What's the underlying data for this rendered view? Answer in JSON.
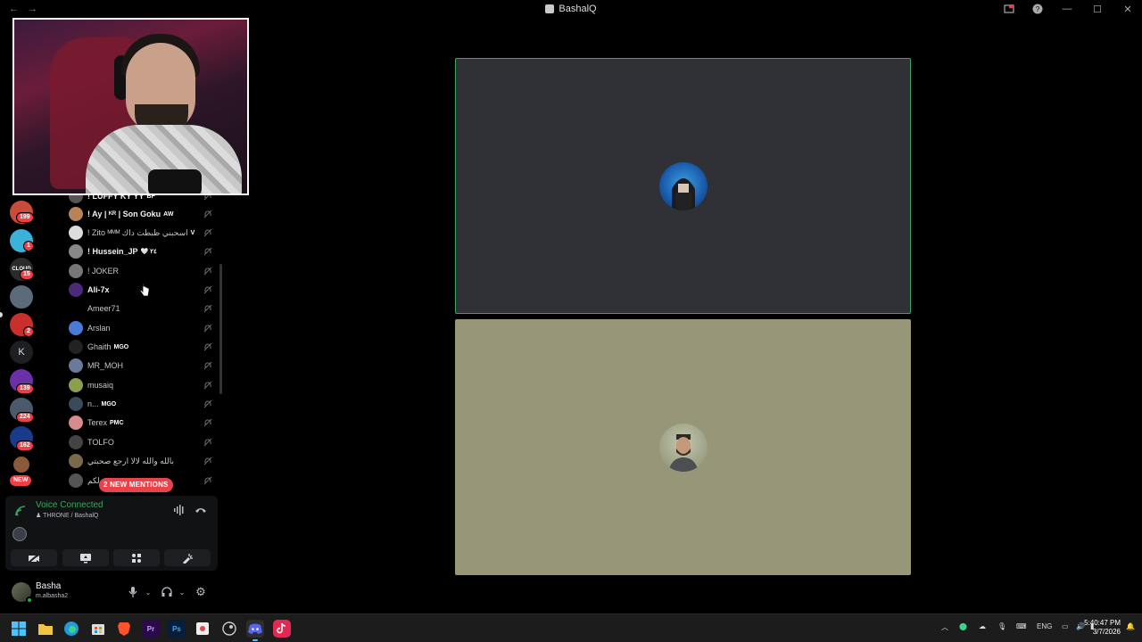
{
  "window": {
    "title": "BashalQ",
    "back": "←",
    "forward": "→",
    "minimize": "—",
    "maximize": "☐",
    "close": "✕"
  },
  "rail": {
    "servers": [
      {
        "name": "server-1",
        "badge": "199",
        "color": "#c94b3a"
      },
      {
        "name": "server-2",
        "badge": "1",
        "color": "#3ab2d9"
      },
      {
        "name": "server-3",
        "badge": "15",
        "label": "CLOUD",
        "color": "#3b3b3b"
      },
      {
        "name": "server-4",
        "badge": "",
        "color": "#5b6b7a"
      },
      {
        "name": "server-5",
        "badge": "2",
        "color": "#c9302c"
      },
      {
        "name": "server-6",
        "badge": "",
        "label": "K",
        "color": "#1e1f22"
      },
      {
        "name": "server-7",
        "badge": "139",
        "color": "#6b2fa8"
      },
      {
        "name": "server-8",
        "badge": "224",
        "color": "#4a5a6a"
      },
      {
        "name": "server-9",
        "badge": "162",
        "color": "#1a3a8a"
      },
      {
        "name": "server-10",
        "badge": "",
        "color": "#8a5a3a"
      }
    ],
    "new_label": "NEW"
  },
  "members": [
    {
      "name": "! LUFFY KY YY",
      "tag": "BF",
      "bold": true,
      "color": "#555"
    },
    {
      "name": "! Ay | ᴷᴿ | Son Goku",
      "tag": "AW",
      "bold": true,
      "color": "#b9835a"
    },
    {
      "name": "! Zito ᴹᴹᴹ اسحبني ظبطت داك",
      "tag": "V",
      "bold": false,
      "color": "#ddd"
    },
    {
      "name": "! Hussein_JP",
      "tag": "🤍 ٢٤",
      "bold": true,
      "color": "#888"
    },
    {
      "name": "! JOKER",
      "tag": "",
      "bold": false,
      "color": "#777"
    },
    {
      "name": "Ali-7x",
      "tag": "",
      "bold": true,
      "color": "#4b2a7a"
    },
    {
      "name": "Ameer71",
      "tag": "",
      "bold": false,
      "color": "#000"
    },
    {
      "name": "Arslan",
      "tag": "",
      "bold": false,
      "color": "#4b7bd9"
    },
    {
      "name": "Ghaith",
      "tag": "MGO",
      "bold": false,
      "color": "#222"
    },
    {
      "name": "MR_MOH",
      "tag": "",
      "bold": false,
      "color": "#6a7a9a"
    },
    {
      "name": "musaiq",
      "tag": "",
      "bold": false,
      "color": "#8aa04a"
    },
    {
      "name": "n...",
      "tag": "MGO",
      "bold": false,
      "color": "#3a4a5a"
    },
    {
      "name": "Terex",
      "tag": "PMC",
      "bold": false,
      "color": "#d98a8a"
    },
    {
      "name": "TOLFO",
      "tag": "",
      "bold": false,
      "color": "#444"
    },
    {
      "name": "بالله والله لالا ارجع صحبتي",
      "tag": "",
      "bold": false,
      "color": "#7a6a4a"
    },
    {
      "name": "لكم",
      "tag": "",
      "bold": false,
      "color": "#555"
    }
  ],
  "mentions_label": "2 NEW MENTIONS",
  "voice": {
    "status": "Voice Connected",
    "channel": "THRONE / BashalQ"
  },
  "user": {
    "name": "Basha",
    "status": "m.albasha2"
  },
  "taskbar": {
    "lang": "ENG",
    "time": "5:40:47 PM",
    "date": "3/7/2026"
  },
  "colors": {
    "accent_green": "#3ba55d",
    "mention_red": "#e8434b",
    "tile_dark": "#2f3136",
    "tile_olive": "#979679"
  }
}
